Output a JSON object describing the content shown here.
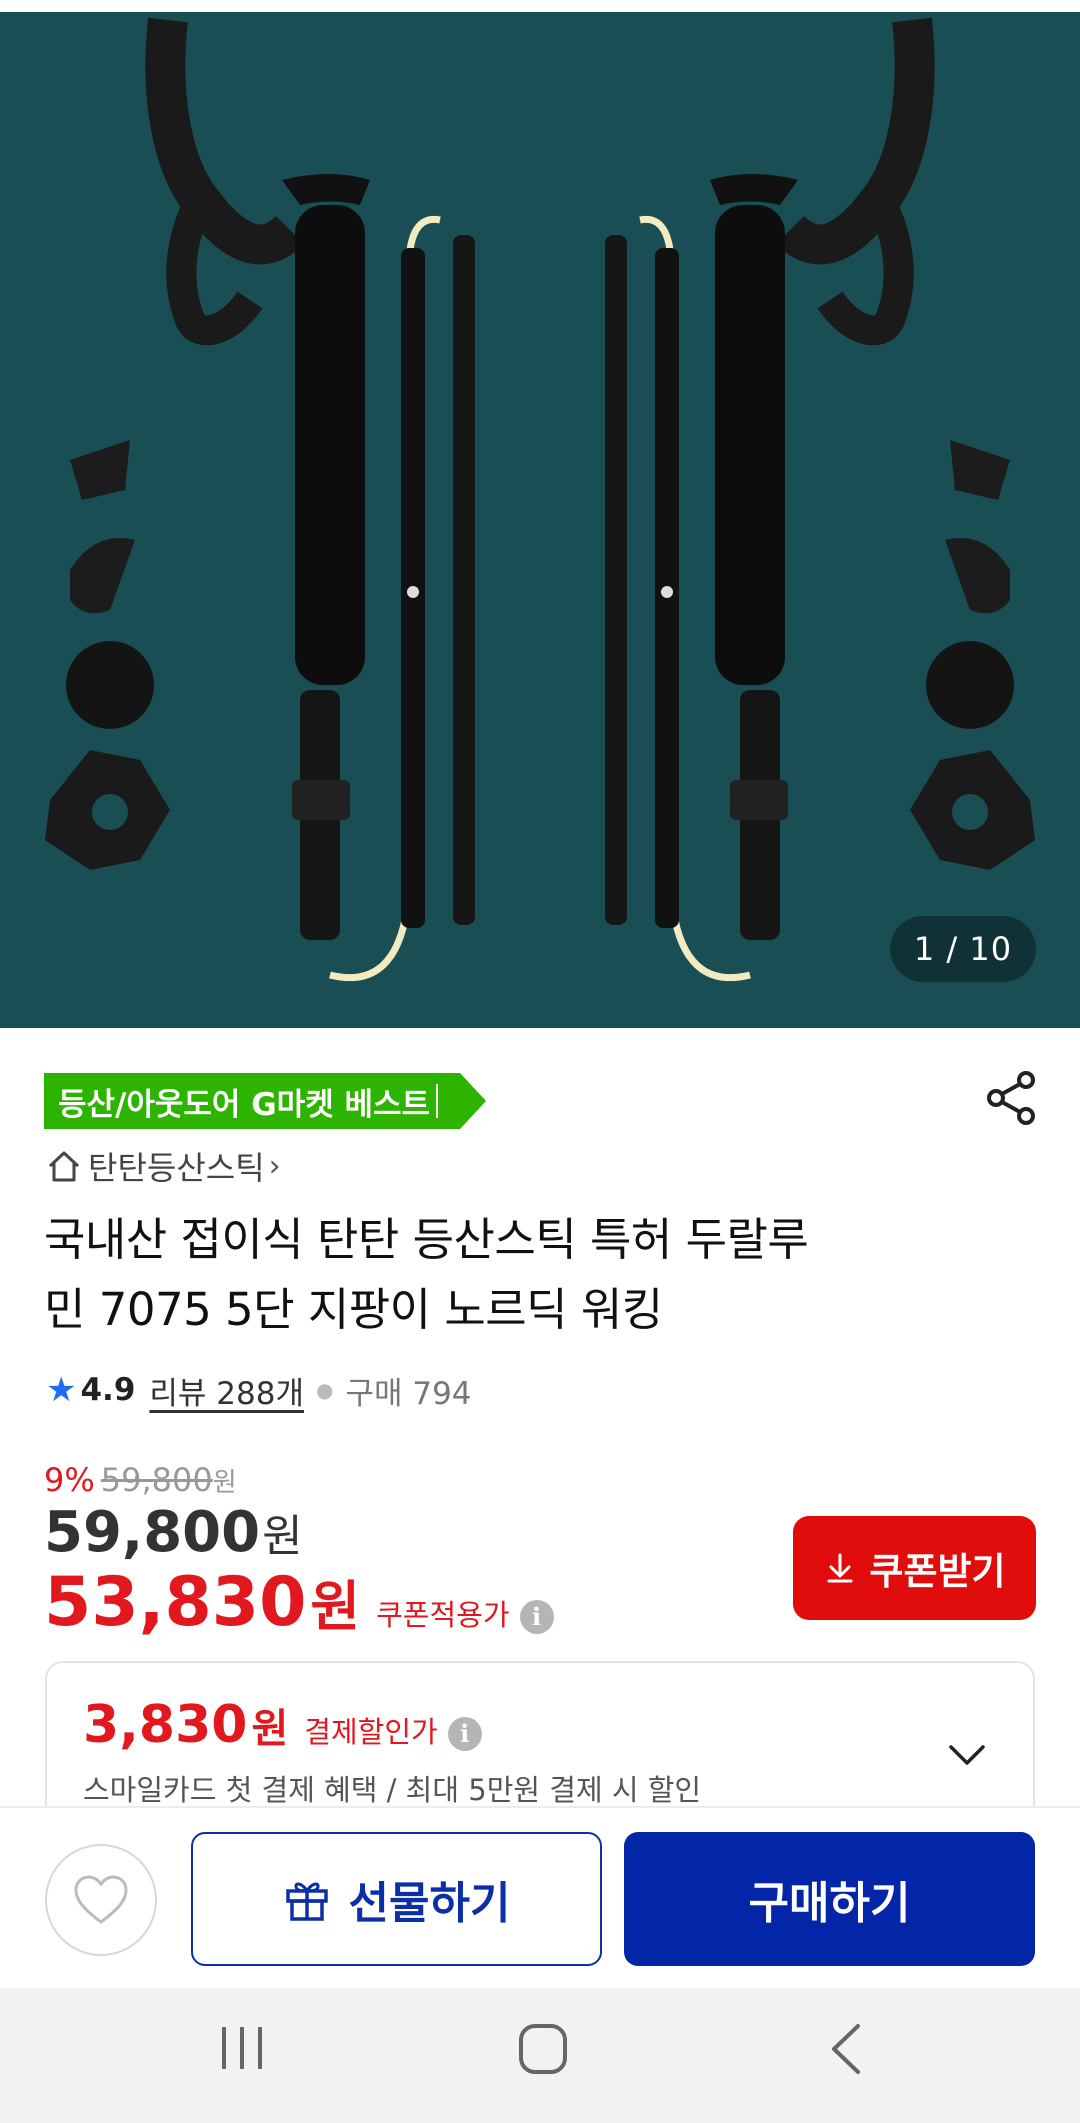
{
  "hero": {
    "counter": "1 / 10",
    "background": "#1a4e55"
  },
  "product": {
    "badge": "등산/아웃도어 G마켓 베스트",
    "store": "탄탄등산스틱",
    "title_line1": "국내산 접이식 탄탄 등산스틱 특허 두랄루",
    "title_line2": "민 7075 5단 지팡이 노르딕 워킹",
    "rating": "4.9",
    "review_label": "리뷰 288개",
    "purchase_label": "구매 794"
  },
  "price": {
    "discount_pct": "9%",
    "original": "59,800",
    "won_small": "원",
    "price": "59,800",
    "won": "원",
    "coupon_price": "53,830",
    "coupon_label": "쿠폰적용가",
    "coupon_button": "쿠폰받기"
  },
  "payment": {
    "amount": "3,830",
    "won": "원",
    "label": "결제할인가",
    "description": "스마일카드 첫 결제 혜택 / 최대 5만원 결제 시 할인"
  },
  "actions": {
    "gift": "선물하기",
    "buy": "구매하기"
  },
  "colors": {
    "accent_red": "#e10c0c",
    "accent_blue": "#0326a9",
    "badge_green": "#2db400",
    "star_blue": "#1e6cf0"
  }
}
